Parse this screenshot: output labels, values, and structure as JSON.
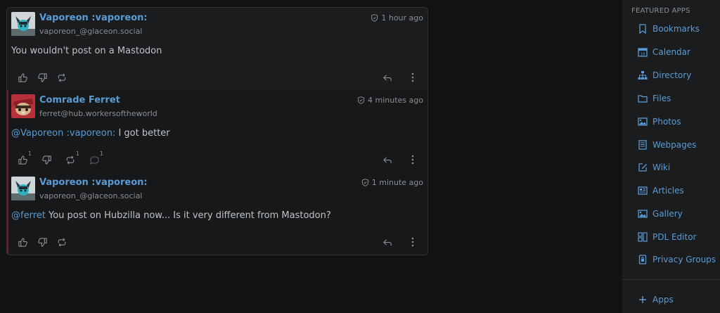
{
  "thread": {
    "posts": [
      {
        "author": "Vaporeon :vaporeon:",
        "handle": "vaporeon_@glaceon.social",
        "time": "1 hour ago",
        "text": "You wouldn't post on a Mastodon",
        "mention": "",
        "avatar": "vaporeon-avatar"
      },
      {
        "author": "Comrade Ferret",
        "handle": "ferret@hub.workersoftheworld",
        "time": "4 minutes ago",
        "mention": "@Vaporeon :vaporeon:",
        "text": " I got better",
        "like_count": "1",
        "repeat_count": "1",
        "comment_count": "1",
        "avatar": "ferret-avatar"
      },
      {
        "author": "Vaporeon :vaporeon:",
        "handle": "vaporeon_@glaceon.social",
        "time": "1 minute ago",
        "mention": "@ferret",
        "text": " You post on Hubzilla now... Is it very different from Mastodon?",
        "avatar": "vaporeon-avatar"
      }
    ]
  },
  "sidebar": {
    "title": "FEATURED APPS",
    "items": [
      {
        "label": "Bookmarks",
        "icon": "bookmark-icon"
      },
      {
        "label": "Calendar",
        "icon": "calendar-icon"
      },
      {
        "label": "Directory",
        "icon": "sitemap-icon"
      },
      {
        "label": "Files",
        "icon": "folder-icon"
      },
      {
        "label": "Photos",
        "icon": "image-icon"
      },
      {
        "label": "Webpages",
        "icon": "document-icon"
      },
      {
        "label": "Wiki",
        "icon": "pencil-square-icon"
      },
      {
        "label": "Articles",
        "icon": "newspaper-icon"
      },
      {
        "label": "Gallery",
        "icon": "image-icon"
      },
      {
        "label": "PDL Editor",
        "icon": "layout-icon"
      },
      {
        "label": "Privacy Groups",
        "icon": "lock-icon"
      }
    ],
    "apps_label": "Apps"
  },
  "colors": {
    "accent": "#5b9bd5",
    "background": "#111212",
    "panel": "#1b1c1e",
    "thread_border_accent": "#6b1f28"
  }
}
